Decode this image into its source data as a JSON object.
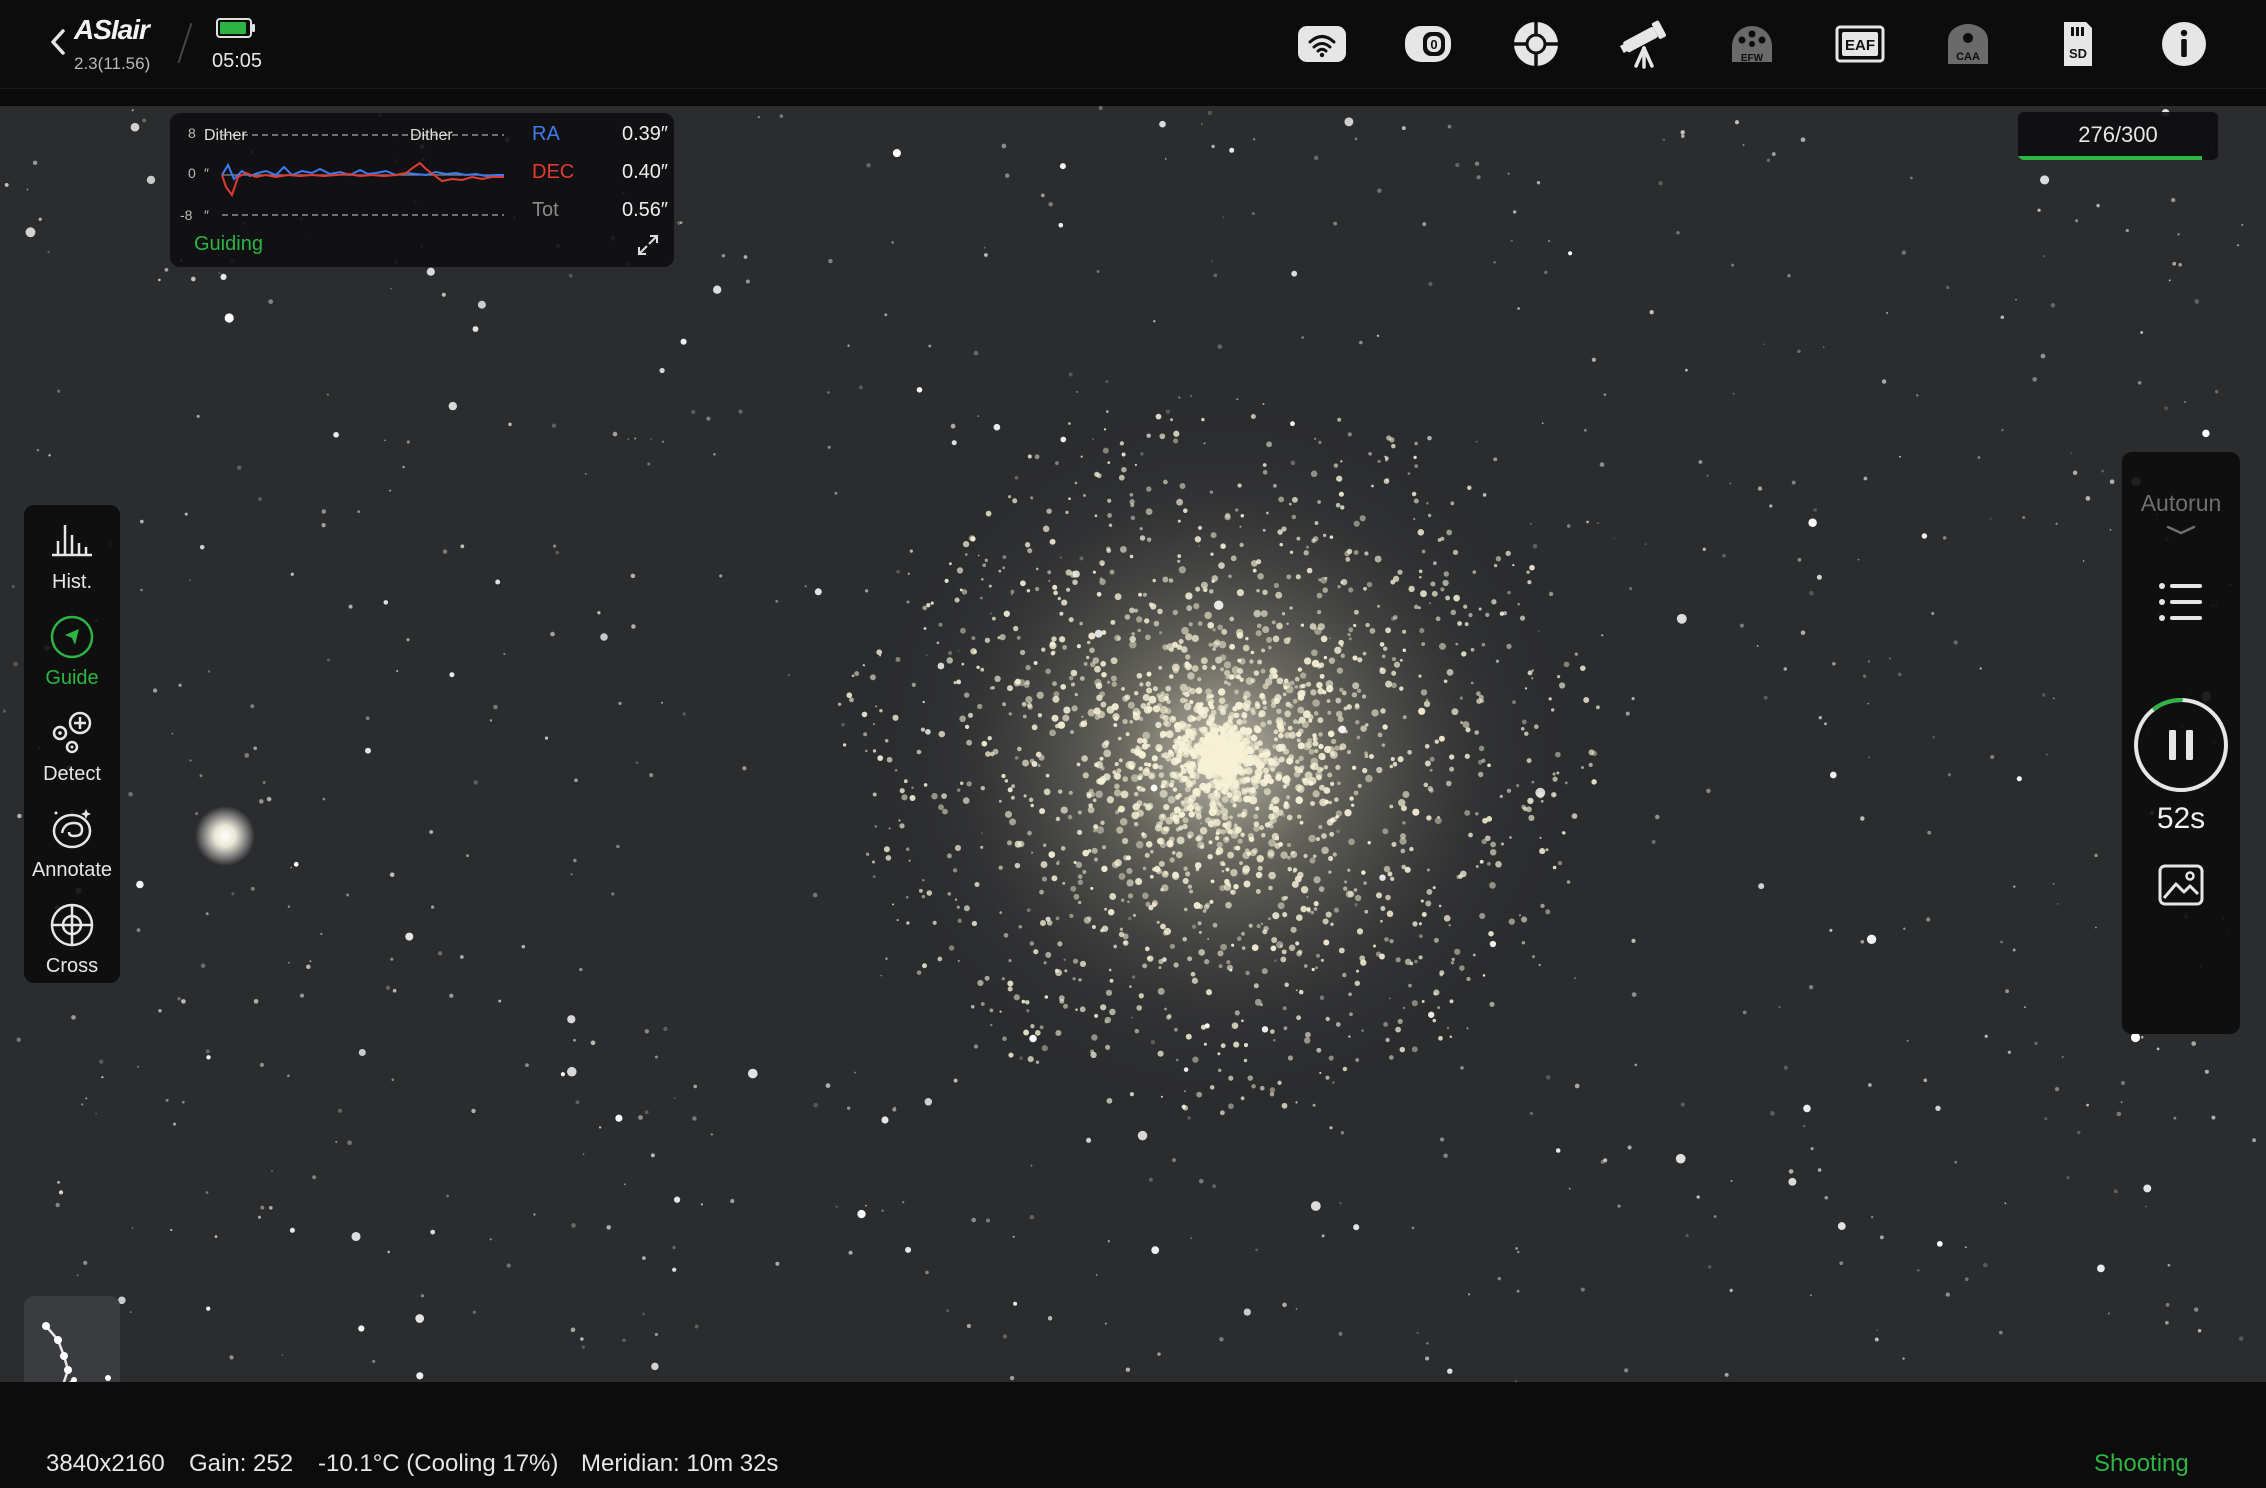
{
  "app": {
    "logo_text": "ASIair",
    "version": "2.3(11.56)",
    "time": "05:05"
  },
  "topbar": {
    "icons": [
      "wifi-icon",
      "camera-settings-icon",
      "guide-scope-icon",
      "telescope-mount-icon",
      "efw-icon",
      "eaf-icon",
      "caa-icon",
      "sd-card-icon",
      "info-icon"
    ],
    "efw_label": "EFW",
    "eaf_label": "EAF",
    "caa_label": "CAA",
    "sd_label": "SD"
  },
  "guide_panel": {
    "axis_top": "8",
    "axis_mid": "0",
    "axis_bottom": "-8",
    "unit": "″",
    "dither_label_1": "Dither",
    "dither_label_2": "Dither",
    "ra_label": "RA",
    "ra_value": "0.39″",
    "dec_label": "DEC",
    "dec_value": "0.40″",
    "tot_label": "Tot",
    "tot_value": "0.56″",
    "status": "Guiding",
    "colors": {
      "ra": "#3d7cf0",
      "dec": "#e23b32",
      "status": "#2db544"
    }
  },
  "frame_counter": {
    "text": "276/300",
    "progress": 0.92
  },
  "left_toolbar": {
    "hist": "Hist.",
    "guide": "Guide",
    "detect": "Detect",
    "annotate": "Annotate",
    "cross": "Cross"
  },
  "right_panel": {
    "autorun": "Autorun",
    "countdown": "52s",
    "exposure_progress": 0.1
  },
  "statusbar": {
    "resolution": "3840x2160",
    "gain": "Gain: 252",
    "temperature": "-10.1°C (Cooling 17%)",
    "meridian": "Meridian: 10m 32s",
    "state": "Shooting"
  }
}
